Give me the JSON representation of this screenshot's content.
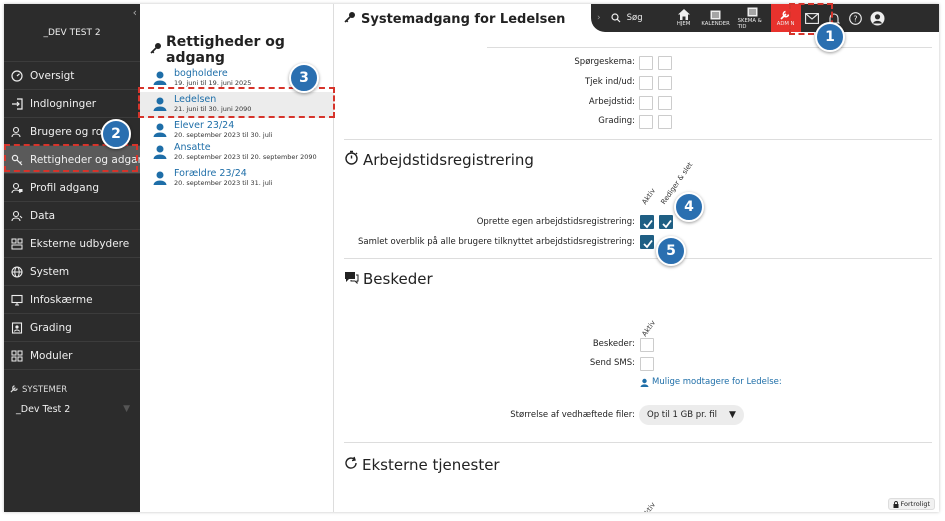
{
  "sidebar": {
    "org": "_DEV TEST 2",
    "items": [
      {
        "label": "Oversigt",
        "icon": "dashboard-icon"
      },
      {
        "label": "Indlogninger",
        "icon": "login-icon"
      },
      {
        "label": "Brugere og roller",
        "icon": "users-icon"
      },
      {
        "label": "Rettigheder og adgang",
        "icon": "key-icon"
      },
      {
        "label": "Profil adgang",
        "icon": "profile-access-icon"
      },
      {
        "label": "Data",
        "icon": "data-icon"
      },
      {
        "label": "Eksterne udbydere",
        "icon": "external-providers-icon"
      },
      {
        "label": "System",
        "icon": "globe-icon"
      },
      {
        "label": "Infoskærme",
        "icon": "monitor-icon"
      },
      {
        "label": "Grading",
        "icon": "grading-icon"
      },
      {
        "label": "Moduler",
        "icon": "modules-icon"
      }
    ],
    "systems_label": "SYSTEMER",
    "system_select": "_Dev Test 2"
  },
  "list": {
    "title": "Rettigheder og adgang",
    "items": [
      {
        "name": "bogholdere",
        "date": "19. juni til 19. juni 2025"
      },
      {
        "name": "Ledelsen",
        "date": "21. juni til 30. juni 2090"
      },
      {
        "name": "Elever 23/24",
        "date": "20. september 2023 til 30. juli"
      },
      {
        "name": "Ansatte",
        "date": "20. september 2023 til 20. september 2090"
      },
      {
        "name": "Forældre 23/24",
        "date": "20. september 2023 til 31. juli"
      }
    ]
  },
  "topbar": {
    "title": "Systemadgang for Ledelsen",
    "search": "Søg",
    "nav": {
      "home": "HJEM",
      "calendar": "KALENDER",
      "schedule": "SKEMA & TID",
      "admin": "ADMIN"
    }
  },
  "main": {
    "top_rows": [
      "Spørgeskema:",
      "Tjek ind/ud:",
      "Arbejdstid:",
      "Grading:"
    ],
    "work_section": {
      "title": "Arbejdstidsregistrering",
      "col_active": "Aktiv",
      "col_edit": "Rediger & slet",
      "rows": [
        {
          "label": "Oprette egen arbejdstidsregistrering:"
        },
        {
          "label": "Samlet overblik på alle brugere tilknyttet arbejdstidsregistrering:"
        }
      ]
    },
    "messages_section": {
      "title": "Beskeder",
      "col_active": "Aktiv",
      "rows": [
        "Beskeder:",
        "Send SMS:"
      ],
      "link": "Mulige modtagere for Ledelse:",
      "attachment_label": "Størrelse af vedhæftede filer:",
      "attachment_value": "Op til 1 GB pr. fil"
    },
    "external_section": {
      "title": "Eksterne tjenester",
      "col_active": "Aktiv"
    },
    "confidential": "Fortroligt"
  },
  "annotations": [
    "1",
    "2",
    "3",
    "4",
    "5"
  ]
}
